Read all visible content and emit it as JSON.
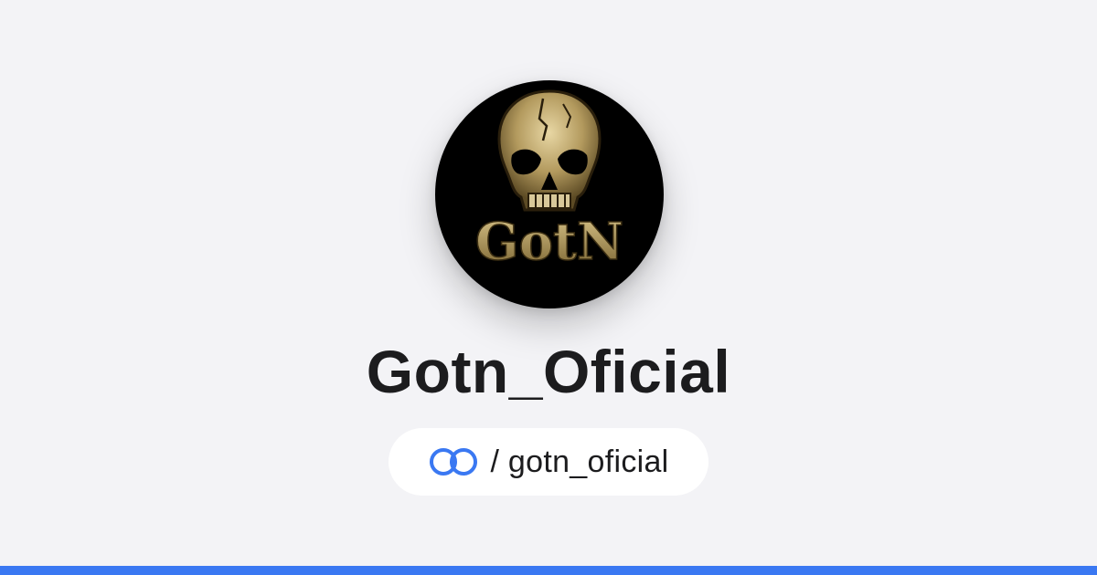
{
  "profile": {
    "display_name": "Gotn_Oficial",
    "handle": "/ gotn_oficial",
    "avatar_logo_text": "GotN"
  },
  "icons": {
    "brand": "linked-rings-icon"
  },
  "colors": {
    "background": "#f3f3f6",
    "accent": "#3a78f2",
    "avatar_gold": "#b8a16a",
    "text": "#1c1c1e"
  }
}
